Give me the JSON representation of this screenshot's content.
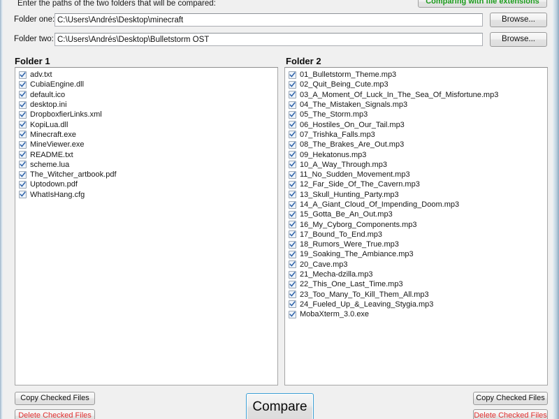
{
  "window": {
    "instructions": "Enter the paths of the two folders that will be compared:"
  },
  "status": {
    "label": "Comparing with file extensions",
    "color": "#1a9a1a"
  },
  "paths": {
    "folder_one": {
      "label": "Folder one:",
      "value": "C:\\Users\\Andrés\\Desktop\\minecraft",
      "placeholder": "",
      "browse_label": "Browse..."
    },
    "folder_two": {
      "label": "Folder two:",
      "value": "C:\\Users\\Andrés\\Desktop\\Bulletstorm OST",
      "placeholder": "",
      "browse_label": "Browse..."
    }
  },
  "panels": {
    "left": {
      "heading": "Folder 1",
      "files": [
        {
          "name": "adv.txt",
          "checked": true
        },
        {
          "name": "CubiaEngine.dll",
          "checked": true
        },
        {
          "name": "default.ico",
          "checked": true
        },
        {
          "name": "desktop.ini",
          "checked": true
        },
        {
          "name": "DropboxfierLinks.xml",
          "checked": true
        },
        {
          "name": "KopiLua.dll",
          "checked": true
        },
        {
          "name": "Minecraft.exe",
          "checked": true
        },
        {
          "name": "MineViewer.exe",
          "checked": true
        },
        {
          "name": "README.txt",
          "checked": true
        },
        {
          "name": "scheme.lua",
          "checked": true
        },
        {
          "name": "The_Witcher_artbook.pdf",
          "checked": true
        },
        {
          "name": "Uptodown.pdf",
          "checked": true
        },
        {
          "name": "WhatIsHang.cfg",
          "checked": true
        }
      ],
      "copy_label": "Copy Checked Files",
      "delete_label": "Delete Checked Files"
    },
    "right": {
      "heading": "Folder 2",
      "files": [
        {
          "name": "01_Bulletstorm_Theme.mp3",
          "checked": true
        },
        {
          "name": "02_Quit_Being_Cute.mp3",
          "checked": true
        },
        {
          "name": "03_A_Moment_Of_Luck_In_The_Sea_Of_Misfortune.mp3",
          "checked": true
        },
        {
          "name": "04_The_Mistaken_Signals.mp3",
          "checked": true
        },
        {
          "name": "05_The_Storm.mp3",
          "checked": true
        },
        {
          "name": "06_Hostiles_On_Our_Tail.mp3",
          "checked": true
        },
        {
          "name": "07_Trishka_Falls.mp3",
          "checked": true
        },
        {
          "name": "08_The_Brakes_Are_Out.mp3",
          "checked": true
        },
        {
          "name": "09_Hekatonus.mp3",
          "checked": true
        },
        {
          "name": "10_A_Way_Through.mp3",
          "checked": true
        },
        {
          "name": "11_No_Sudden_Movement.mp3",
          "checked": true
        },
        {
          "name": "12_Far_Side_Of_The_Cavern.mp3",
          "checked": true
        },
        {
          "name": "13_Skull_Hunting_Party.mp3",
          "checked": true
        },
        {
          "name": "14_A_Giant_Cloud_Of_Impending_Doom.mp3",
          "checked": true
        },
        {
          "name": "15_Gotta_Be_An_Out.mp3",
          "checked": true
        },
        {
          "name": "16_My_Cyborg_Components.mp3",
          "checked": true
        },
        {
          "name": "17_Bound_To_End.mp3",
          "checked": true
        },
        {
          "name": "18_Rumors_Were_True.mp3",
          "checked": true
        },
        {
          "name": "19_Soaking_The_Ambiance.mp3",
          "checked": true
        },
        {
          "name": "20_Cave.mp3",
          "checked": true
        },
        {
          "name": "21_Mecha-dzilla.mp3",
          "checked": true
        },
        {
          "name": "22_This_One_Last_Time.mp3",
          "checked": true
        },
        {
          "name": "23_Too_Many_To_Kill_Them_All.mp3",
          "checked": true
        },
        {
          "name": "24_Fueled_Up_&_Leaving_Stygia.mp3",
          "checked": true
        },
        {
          "name": "MobaXterm_3.0.exe",
          "checked": true
        }
      ],
      "copy_label": "Copy Checked Files",
      "delete_label": "Delete Checked Files"
    }
  },
  "compare": {
    "label": "Compare"
  }
}
